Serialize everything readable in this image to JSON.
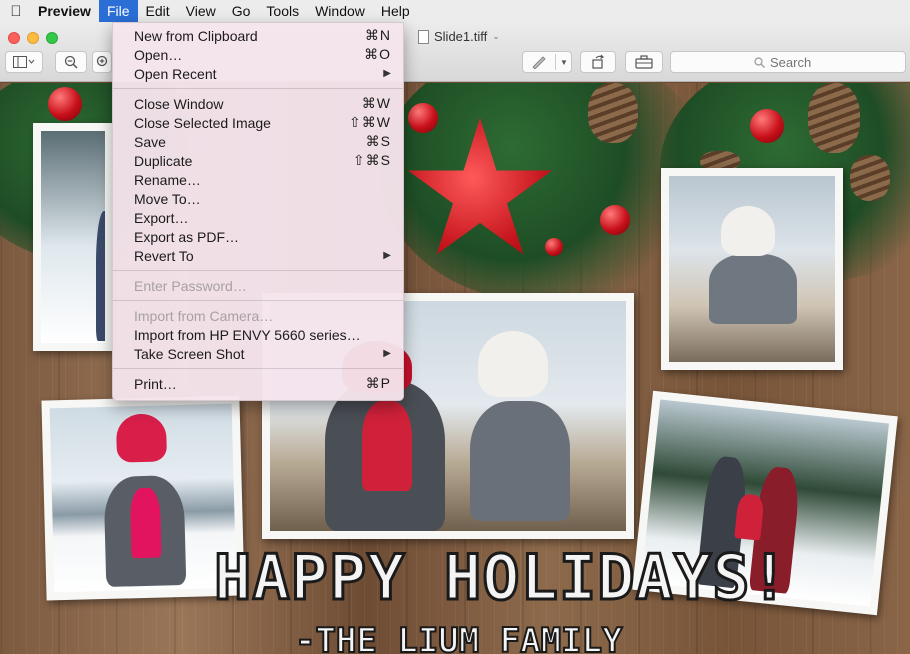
{
  "menubar": {
    "app_name": "Preview",
    "items": [
      "File",
      "Edit",
      "View",
      "Go",
      "Tools",
      "Window",
      "Help"
    ]
  },
  "window": {
    "title": "Slide1.tiff",
    "search_placeholder": "Search"
  },
  "file_menu": {
    "groups": [
      [
        {
          "label": "New from Clipboard",
          "shortcut": "⌘N"
        },
        {
          "label": "Open…",
          "shortcut": "⌘O"
        },
        {
          "label": "Open Recent",
          "submenu": "▶"
        }
      ],
      [
        {
          "label": "Close Window",
          "shortcut": "⌘W"
        },
        {
          "label": "Close Selected Image",
          "shortcut": "⇧⌘W"
        },
        {
          "label": "Save",
          "shortcut": "⌘S"
        },
        {
          "label": "Duplicate",
          "shortcut": "⇧⌘S"
        },
        {
          "label": "Rename…"
        },
        {
          "label": "Move To…"
        },
        {
          "label": "Export…"
        },
        {
          "label": "Export as PDF…"
        },
        {
          "label": "Revert To",
          "submenu": "▶"
        }
      ],
      [
        {
          "label": "Enter Password…",
          "disabled": true
        }
      ],
      [
        {
          "label": "Import from Camera…",
          "disabled": true
        },
        {
          "label": "Import from HP ENVY 5660 series…"
        },
        {
          "label": "Take Screen Shot",
          "submenu": "▶"
        }
      ],
      [
        {
          "label": "Print…",
          "shortcut": "⌘P"
        }
      ]
    ]
  },
  "document": {
    "headline": "HAPPY HOLIDAYS!",
    "signature": "-THE LIUM FAMILY"
  },
  "icons": {
    "apple": "apple-icon",
    "sidebar": "sidebar-toggle-icon",
    "zoom_out": "zoom-out-icon",
    "zoom_in": "zoom-in-icon",
    "markup": "markup-pen-icon",
    "rotate": "rotate-icon",
    "toolbox": "toolbox-icon",
    "search": "search-icon"
  }
}
